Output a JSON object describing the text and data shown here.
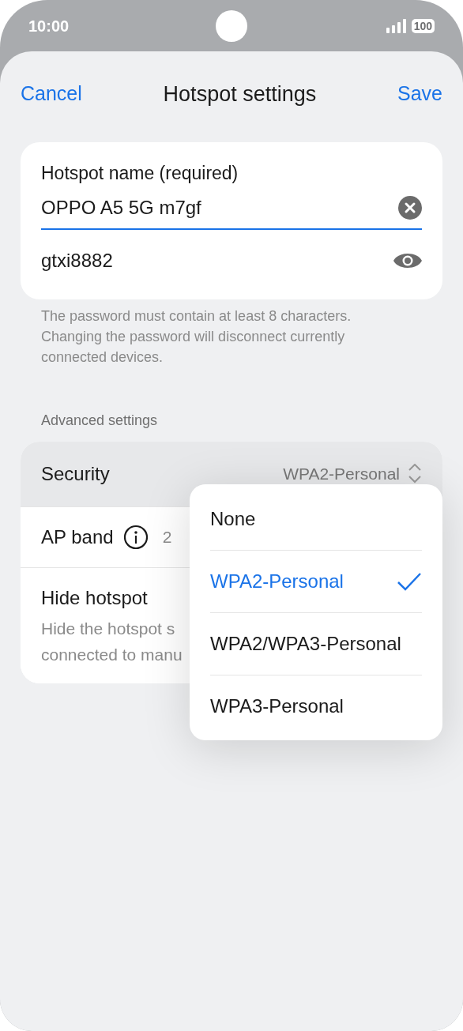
{
  "status_bar": {
    "time": "10:00",
    "battery": "100"
  },
  "header": {
    "cancel": "Cancel",
    "title": "Hotspot settings",
    "save": "Save"
  },
  "name_field": {
    "label": "Hotspot name (required)",
    "value": "OPPO A5 5G m7gf",
    "focused": true
  },
  "password_field": {
    "value": "gtxi8882"
  },
  "hint": "The password must contain at least 8 characters. Changing the password will disconnect currently connected devices.",
  "section_title": "Advanced settings",
  "rows": [
    {
      "kind": "select",
      "label": "Security",
      "value": "WPA2-Personal",
      "pressed": true
    },
    {
      "kind": "info",
      "label": "AP band",
      "value": "2",
      "pressed": false
    },
    {
      "kind": "toggle",
      "label": "Hide hotspot",
      "description": "Hide the hotspot s\nconnected to manu",
      "pressed": false
    }
  ],
  "dropdown": {
    "options": [
      {
        "label": "None",
        "selected": false
      },
      {
        "label": "WPA2-Personal",
        "selected": true
      },
      {
        "label": "WPA2/WPA3-Personal",
        "selected": false
      },
      {
        "label": "WPA3-Personal",
        "selected": false
      }
    ]
  }
}
